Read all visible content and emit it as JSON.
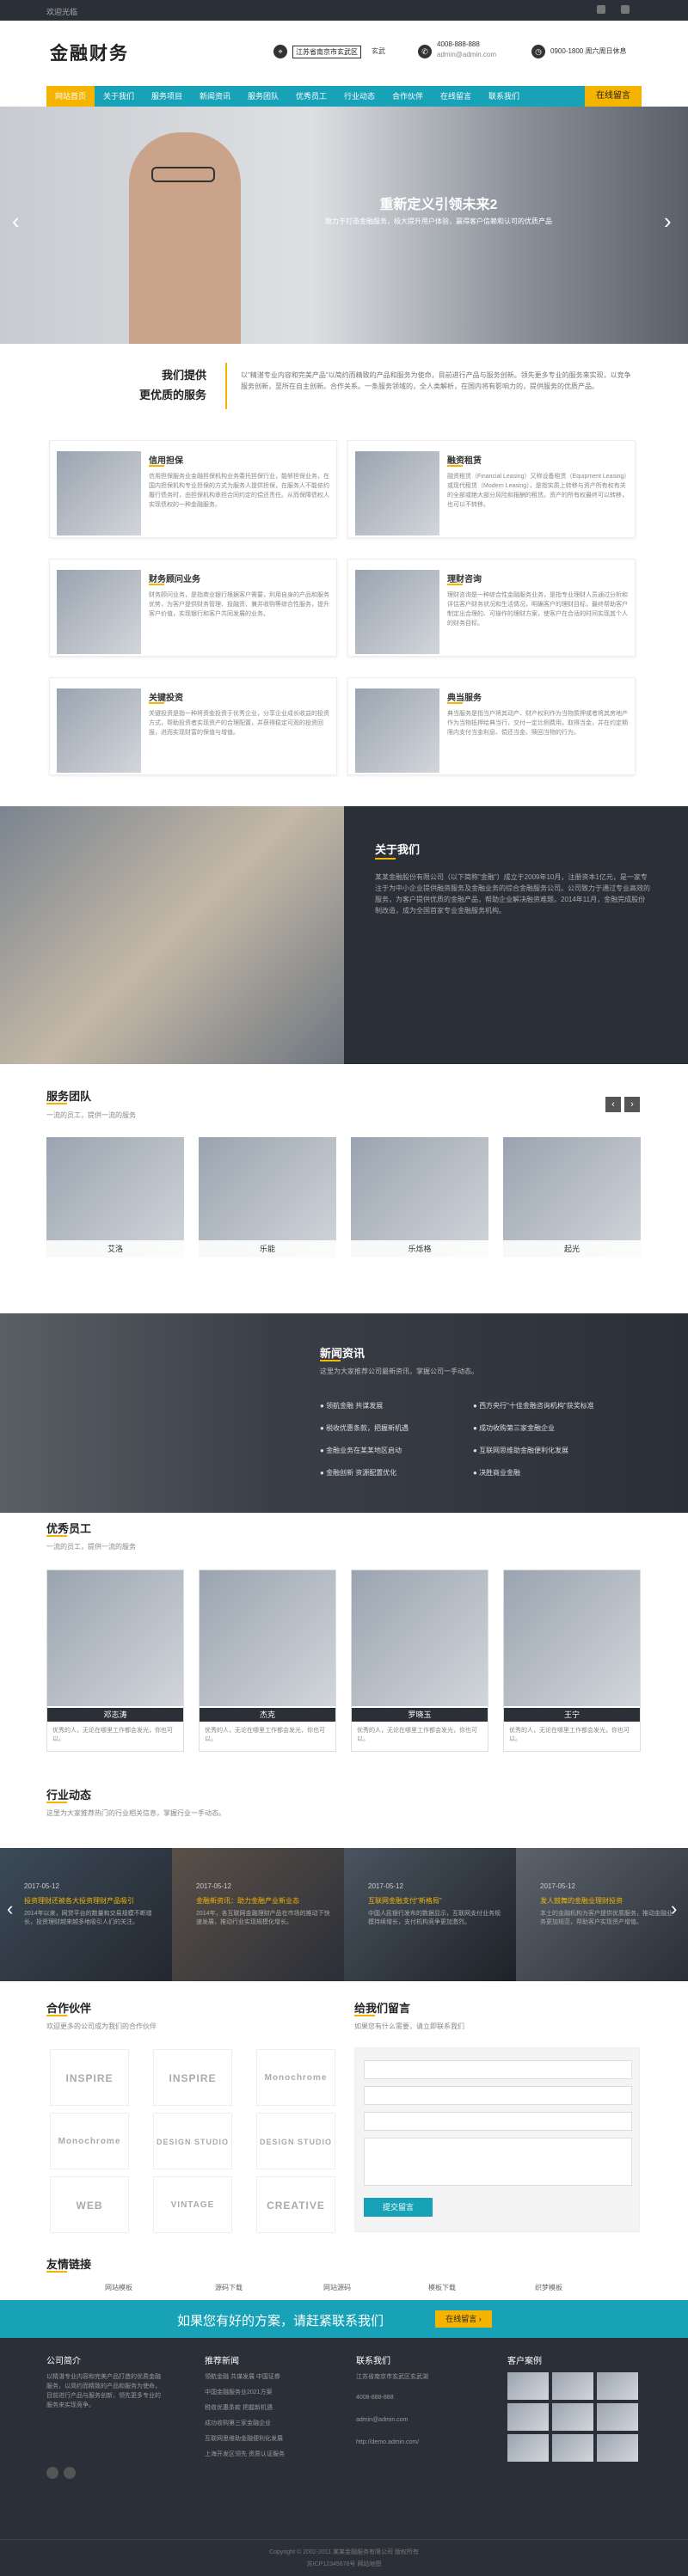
{
  "topbar": {
    "welcome": "欢迎光临"
  },
  "header": {
    "logo": "金融财务",
    "address": "江苏省南京市玄武区",
    "address2": "玄武",
    "phone": "4008-888-888",
    "email": "admin@admin.com",
    "hours": "0900-1800 周六周日休息"
  },
  "nav": {
    "items": [
      "网站首页",
      "关于我们",
      "服务项目",
      "新闻资讯",
      "服务团队",
      "优秀员工",
      "行业动态",
      "合作伙伴",
      "在线留言",
      "联系我们"
    ],
    "message": "在线留言"
  },
  "banner": {
    "title": "重新定义引领未来2",
    "subtitle": "致力于打造金融服务，极大提升用户体验，赢得客户信赖和认可的优质产品"
  },
  "services": {
    "heading1": "我们提供",
    "heading2": "更优质的服务",
    "intro": "以\"精湛专业内容和完美产品\"以简约而精致的产品和服务为使命，目前进行产品与服务创新。领先更多专业的服务来实现，以竞争服务创新，至所在自主创新。合作关系。一条服务领域的，全人类解析，在国内将有影响力的，提供服务的优质产品。",
    "items": [
      {
        "title": "信用担保",
        "desc": "信用担保服务业金融担保机构业务委托担保行业，能够担保业务，在国内担保机构专业担保的方式为服务人提供担保，在服务人不能依约履行债务时，由担保机构承担合同约定的偿还责任。从而保障债权人实现债权的一种金融服务。"
      },
      {
        "title": "融资租赁",
        "desc": "融资租赁（Financial Leasing）又称设备租赁（Equipment Leasing）或现代租赁（Modern Leasing），是指实质上转移与资产所有权有关的全部或绝大部分风险和报酬的租赁。资产的所有权最终可以转移，也可以不转移。"
      },
      {
        "title": "财务顾问业务",
        "desc": "财务顾问业务，是指商业银行根据客户需要，利用自身的产品和服务优势，为客户提供财务管理、投融资、兼并收购等综合性服务，提升客户价值，实现银行和客户共同发展的业务。"
      },
      {
        "title": "理财咨询",
        "desc": "理财咨询是一种综合性金融服务业务，是指专业理财人员通过分析和评估客户财务状况和生活情况，明确客户的理财目标，最终帮助客户制定出合理的、可操作的理财方案，使客户在合适的时间实现其个人的财务目标。"
      },
      {
        "title": "关键投资",
        "desc": "关键投资是指一种将资金投资于优秀企业，分享企业成长收益的投资方式，帮助投资者实现资产的合理配置，并获得稳定可观的投资回报，进而实现财富的保值与增值。"
      },
      {
        "title": "典当服务",
        "desc": "典当服务是指当户将其动产、财产权利作为当物质押或者将其房地产作为当物抵押给典当行，交付一定比例费用，取得当金，并在约定期限内支付当金利息、偿还当金、赎回当物的行为。"
      }
    ]
  },
  "about": {
    "title": "关于我们",
    "text": "某某金融股份有限公司（以下简称\"金融\"）成立于2009年10月，注册资本1亿元，是一家专注于为中小企业提供融资服务及金融业务的综合金融服务公司。公司致力于通过专业高效的服务，为客户提供优质的金融产品，帮助企业解决融资难题。2014年11月，金融完成股份制改造，成为全国首家专业金融服务机构。"
  },
  "team": {
    "title": "服务团队",
    "sub": "一流的员工，提供一流的服务",
    "prev": "‹",
    "next": "›",
    "members": [
      "艾洛",
      "乐能",
      "乐烁格",
      "起光"
    ]
  },
  "news": {
    "title": "新闻资讯",
    "sub": "这里为大家推荐公司最新资讯，掌握公司一手动态。",
    "items": [
      "领航金融 共谋发展",
      "西方央行\"十佳金融咨询机构\"获奖标准",
      "税收优惠条款，把握新机遇",
      "成功收购第三家金融企业",
      "金融业务在某某地区启动",
      "互联网思维助金融便利化发展",
      "金融创新 资源配置优化",
      "决胜商业金融"
    ]
  },
  "staff": {
    "title": "优秀员工",
    "sub": "一流的员工，提供一流的服务",
    "items": [
      {
        "name": "邓志涛",
        "desc": "优秀的人，无论在哪里工作都会发光，你也可以。"
      },
      {
        "name": "杰克",
        "desc": "优秀的人，无论在哪里工作都会发光，你也可以。"
      },
      {
        "name": "罗晓玉",
        "desc": "优秀的人，无论在哪里工作都会发光，你也可以。"
      },
      {
        "name": "王宁",
        "desc": "优秀的人，无论在哪里工作都会发光，你也可以。"
      }
    ]
  },
  "industry": {
    "title": "行业动态",
    "sub": "这里为大家推荐热门的行业相关信息，掌握行业一手动态。",
    "items": [
      {
        "date": "2017-05-12",
        "title": "投资理财还被各大投资理财产品吸引",
        "desc": "2014年以来，网贷平台的数量和交易规模不断增长，投资理财越来越多地吸引人们的关注。"
      },
      {
        "date": "2017-05-12",
        "title": "金融新资讯：助力金融产业新业态",
        "desc": "2014年，各互联网金融理财产品在市场的推动下快速发展，推动行业实现规模化增长。"
      },
      {
        "date": "2017-05-12",
        "title": "互联网金融支付\"新格局\"",
        "desc": "中国人民银行发布的数据显示，互联网支付业务规模持续增长，支付机构竞争更加激烈。"
      },
      {
        "date": "2017-05-12",
        "title": "发人鼓舞的金融业理财投资",
        "desc": "本土的金融机构为客户提供优质服务，推动金融业务更加规范，帮助客户实现资产增值。"
      }
    ]
  },
  "partners": {
    "title": "合作伙伴",
    "sub": "欢迎更多的公司成为我们的合作伙伴",
    "logos": [
      "INSPIRE",
      "INSPIRE",
      "Monochrome",
      "Monochrome",
      "DESIGN STUDIO",
      "DESIGN STUDIO",
      "WEB",
      "VINTAGE",
      "CREATIVE"
    ]
  },
  "contact_form": {
    "title": "给我们留言",
    "sub": "如果您有什么需要，请立即联系我们",
    "submit": "提交留言"
  },
  "links": {
    "title": "友情链接",
    "items": [
      "网站模板",
      "源码下载",
      "网站源码",
      "模板下载",
      "织梦模板"
    ]
  },
  "cta": {
    "text": "如果您有好的方案，请赶紧联系我们",
    "button": "在线留言 ›"
  },
  "footer": {
    "about_title": "公司简介",
    "about_text": "以精湛专业内容和完美产品打造的优质金融服务，以简约而精致的产品和服务为使命，目前进行产品与服务创新，领先更多专业的服务来实现竞争。",
    "news_title": "推荐新闻",
    "news": [
      "领航金融 共谋发展 中国证券",
      "中国金融服务业2021方案",
      "税收优惠条款 把握新机遇",
      "成功收购第三家金融企业",
      "互联网思维助金融便利化发展",
      "上海开发区领先 资质认证服务"
    ],
    "contact_title": "联系我们",
    "contact": [
      "江苏省南京市玄武区玄武湖",
      "4008-888-888",
      "admin@admin.com",
      "http://demo.admin.com/"
    ],
    "cases_title": "客户案例",
    "copyright": "Copyright © 2002-2011 某某金融服务有限公司 版权所有",
    "icp": "苏ICP12345678号 网站地图"
  }
}
